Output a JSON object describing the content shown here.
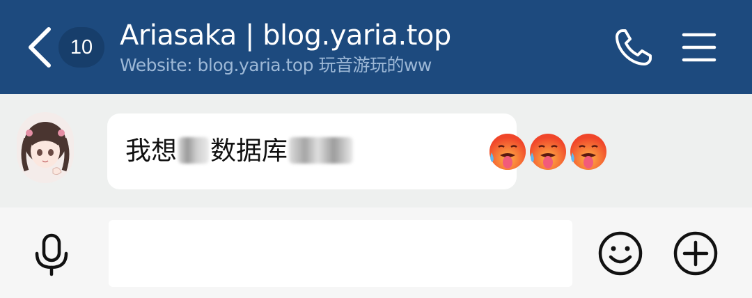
{
  "header": {
    "unread_count": "10",
    "title": "Ariasaka | blog.yaria.top",
    "subtitle": "Website: blog.yaria.top 玩音游玩的ww",
    "bg_color": "#1d4a7e",
    "icons": [
      "back-arrow-icon",
      "phone-icon",
      "menu-icon"
    ]
  },
  "chat": {
    "messages": [
      {
        "sender_avatar": "anime-girl-avatar",
        "text_parts": [
          "我想",
          "数据库"
        ],
        "obscured_segments": 2,
        "emojis": [
          "hot-face-emoji",
          "hot-face-emoji",
          "hot-face-emoji"
        ]
      }
    ]
  },
  "input_bar": {
    "placeholder": "",
    "value": "",
    "icons": [
      "microphone-icon",
      "smiley-icon",
      "plus-circle-icon"
    ]
  }
}
